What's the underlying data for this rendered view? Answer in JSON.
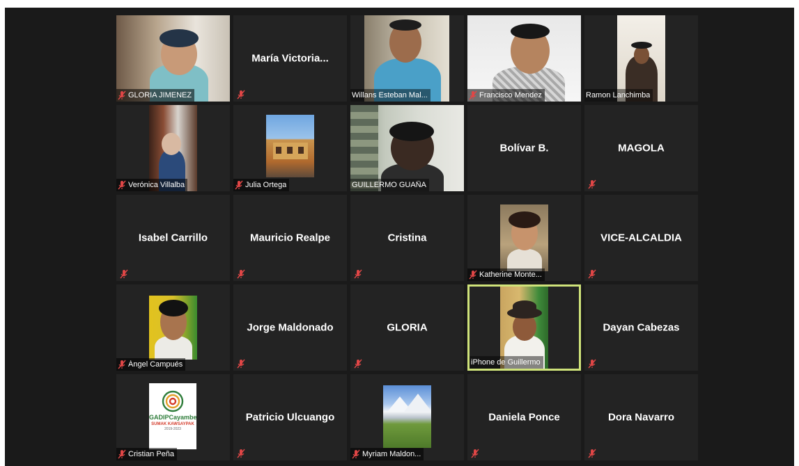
{
  "participants": [
    {
      "name": "GLORIA JIMENEZ",
      "muted": true,
      "video": true
    },
    {
      "name": "María  Victoria...",
      "muted": true,
      "video": false
    },
    {
      "name": "Willans Esteban Mal...",
      "muted": false,
      "video": true
    },
    {
      "name": "Francisco Mendez",
      "muted": true,
      "video": true
    },
    {
      "name": "Ramon Lanchimba",
      "muted": false,
      "video": true
    },
    {
      "name": "Verónica Villalba",
      "muted": true,
      "video": true
    },
    {
      "name": "Julia Ortega",
      "muted": true,
      "video": true
    },
    {
      "name": "GUILLERMO GUAÑA",
      "muted": false,
      "video": true
    },
    {
      "name": "Bolívar B.",
      "muted": false,
      "video": false
    },
    {
      "name": "MAGOLA",
      "muted": true,
      "video": false
    },
    {
      "name": "Isabel Carrillo",
      "muted": true,
      "video": false
    },
    {
      "name": "Mauricio Realpe",
      "muted": true,
      "video": false
    },
    {
      "name": "Cristina",
      "muted": true,
      "video": false
    },
    {
      "name": "Katherine Monte...",
      "muted": true,
      "video": true
    },
    {
      "name": "VICE-ALCALDIA",
      "muted": true,
      "video": false
    },
    {
      "name": "Ángel Campués",
      "muted": true,
      "video": true
    },
    {
      "name": "Jorge Maldonado",
      "muted": true,
      "video": false
    },
    {
      "name": "GLORIA",
      "muted": true,
      "video": false
    },
    {
      "name": "iPhone de Guillermo",
      "muted": false,
      "video": true,
      "active_speaker": true
    },
    {
      "name": "Dayan Cabezas",
      "muted": true,
      "video": false
    },
    {
      "name": "Cristian Peña",
      "muted": true,
      "video": true
    },
    {
      "name": "Patricio Ulcuango",
      "muted": true,
      "video": false
    },
    {
      "name": "Myriam Maldon...",
      "muted": true,
      "video": true
    },
    {
      "name": "Daniela Ponce",
      "muted": true,
      "video": false
    },
    {
      "name": "Dora Navarro",
      "muted": true,
      "video": false
    }
  ],
  "logo": {
    "brand": "GADIPCayambe",
    "subtitle": "SUMAK KAWSAYPAK",
    "years": "2019-2023"
  },
  "colors": {
    "active_speaker_border": "#cfe37a",
    "muted_mic": "#e04646",
    "tile_bg": "#232323",
    "window_bg": "#1a1a1a"
  }
}
